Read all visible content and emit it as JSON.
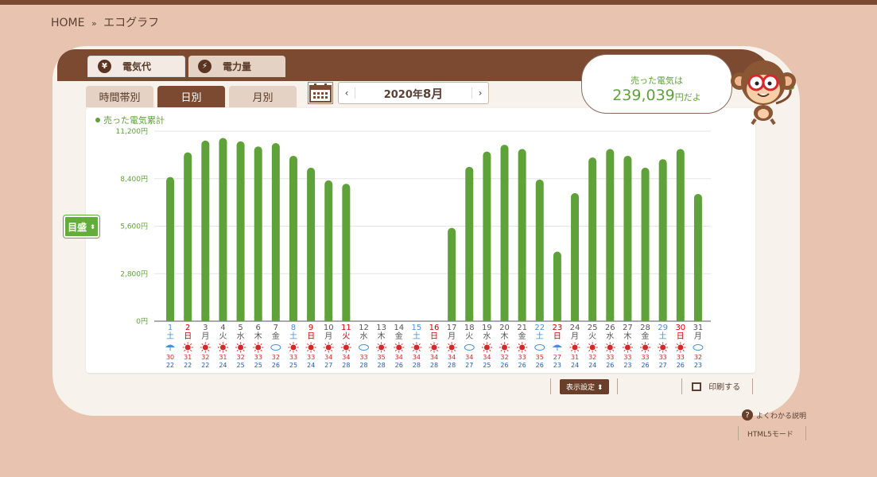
{
  "breadcrumb": {
    "home": "HOME",
    "sep": "»",
    "current": "エコグラフ"
  },
  "main_tabs": [
    {
      "label": "電気代",
      "icon": "¥"
    },
    {
      "label": "電力量",
      "icon": "⚡"
    }
  ],
  "sub_tabs": [
    "時間帯別",
    "日別",
    "月別"
  ],
  "date": {
    "prefix": "2020年",
    "month": "8月",
    "prev": "‹",
    "next": "›"
  },
  "bubble": {
    "label": "売った電気は",
    "value": "239,039",
    "unit": "円だよ"
  },
  "scale_button": "目盛",
  "display_settings": "表示設定",
  "print": "印刷する",
  "help": "よくわかる説明",
  "html5": "HTML5モード",
  "colors": {
    "bar": "#5fa23a",
    "brown": "#7b4a31",
    "blue": "#4a90d9",
    "red": "#cc0000"
  },
  "chart_data": {
    "type": "bar",
    "series": [
      {
        "name": "売った電気累計",
        "color": "#5fa23a"
      }
    ],
    "ylim": [
      0,
      11200
    ],
    "yticks": [
      "0円",
      "2,800円",
      "5,600円",
      "8,400円",
      "11,200円"
    ],
    "categories": [
      "1",
      "2",
      "3",
      "4",
      "5",
      "6",
      "7",
      "8",
      "9",
      "10",
      "11",
      "12",
      "13",
      "14",
      "15",
      "16",
      "17",
      "18",
      "19",
      "20",
      "21",
      "22",
      "23",
      "24",
      "25",
      "26",
      "27",
      "28",
      "29",
      "30",
      "31"
    ],
    "weekday": [
      "土",
      "日",
      "月",
      "火",
      "水",
      "木",
      "金",
      "土",
      "日",
      "月",
      "火",
      "水",
      "木",
      "金",
      "土",
      "日",
      "月",
      "火",
      "水",
      "木",
      "金",
      "土",
      "日",
      "月",
      "火",
      "水",
      "木",
      "金",
      "土",
      "日",
      "月"
    ],
    "day_color": [
      "blue",
      "red",
      "",
      "",
      "",
      "",
      "",
      "blue",
      "red",
      "",
      "red",
      "",
      "",
      "",
      "blue",
      "red",
      "",
      "",
      "",
      "",
      "",
      "blue",
      "red",
      "",
      "",
      "",
      "",
      "",
      "blue",
      "red",
      ""
    ],
    "values": [
      8500,
      9950,
      10650,
      10800,
      10600,
      10300,
      10500,
      9750,
      9050,
      8300,
      8100,
      0,
      0,
      0,
      0,
      0,
      5500,
      9100,
      10000,
      10400,
      10150,
      8350,
      4100,
      7550,
      9650,
      10150,
      9750,
      9050,
      9550,
      10150,
      7500
    ],
    "weather": [
      "rain",
      "sun",
      "sun",
      "sun",
      "sun",
      "sun",
      "cloud",
      "sun",
      "sun",
      "sun",
      "sun",
      "cloud",
      "sun",
      "sun",
      "sun",
      "sun",
      "sun",
      "cloud",
      "sun",
      "sun",
      "sun",
      "cloud",
      "rain",
      "sun",
      "sun",
      "sun",
      "sun",
      "sun",
      "sun",
      "sun",
      "cloud"
    ],
    "high": [
      "30",
      "31",
      "32",
      "31",
      "32",
      "33",
      "32",
      "33",
      "33",
      "34",
      "34",
      "33",
      "35",
      "34",
      "34",
      "34",
      "34",
      "34",
      "34",
      "32",
      "33",
      "35",
      "27",
      "31",
      "32",
      "33",
      "33",
      "33",
      "33",
      "33",
      "32"
    ],
    "low": [
      "22",
      "22",
      "22",
      "24",
      "25",
      "25",
      "26",
      "25",
      "24",
      "27",
      "28",
      "28",
      "28",
      "26",
      "28",
      "28",
      "28",
      "27",
      "25",
      "26",
      "26",
      "26",
      "23",
      "24",
      "24",
      "26",
      "23",
      "26",
      "27",
      "26",
      "23"
    ]
  }
}
